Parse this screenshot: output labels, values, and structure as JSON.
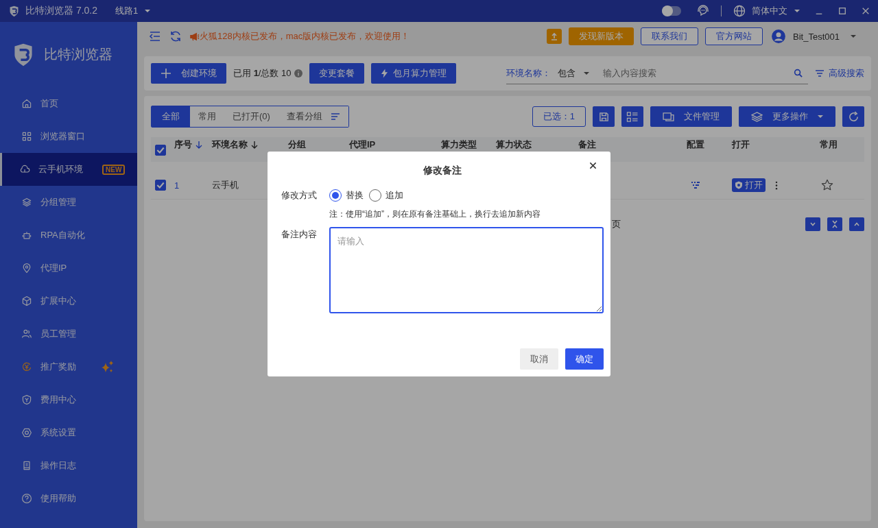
{
  "app": {
    "title": "比特浏览器 7.0.2",
    "line": "线路1",
    "language": "简体中文",
    "dark_mode": false
  },
  "sidebar": {
    "brand": "比特浏览器",
    "items": [
      {
        "label": "首页",
        "selected": false
      },
      {
        "label": "浏览器窗口",
        "selected": false
      },
      {
        "label": "云手机环境",
        "selected": true,
        "badge": "NEW"
      },
      {
        "label": "分组管理",
        "selected": false
      },
      {
        "label": "RPA自动化",
        "selected": false
      },
      {
        "label": "代理IP",
        "selected": false
      },
      {
        "label": "扩展中心",
        "selected": false
      },
      {
        "label": "员工管理",
        "selected": false
      },
      {
        "label": "推广奖励",
        "selected": false,
        "sparkle": true
      },
      {
        "label": "费用中心",
        "selected": false
      },
      {
        "label": "系统设置",
        "selected": false
      },
      {
        "label": "操作日志",
        "selected": false
      },
      {
        "label": "使用帮助",
        "selected": false
      }
    ]
  },
  "header": {
    "notice": "火狐128内核已发布，mac版内核已发布，欢迎使用！",
    "update": "发现新版本",
    "contact": "联系我们",
    "website": "官方网站",
    "user": "Bit_Test001"
  },
  "toolbar": {
    "create": "创建环境",
    "usage": "已用 **1**/总数 10",
    "change_plan": "变更套餐",
    "compute": "包月算力管理",
    "filter_label": "环境名称：",
    "filter_mode": "包含",
    "search": {
      "placeholder": "输入内容搜索"
    },
    "advanced": "高级搜索"
  },
  "tabs": [
    {
      "label": "全部",
      "selected": true
    },
    {
      "label": "常用",
      "selected": false
    },
    {
      "label": "已打开(0)",
      "selected": false
    },
    {
      "label": "查看分组",
      "selected": false
    }
  ],
  "actions": {
    "selected_count": "已选：1",
    "files": "文件管理",
    "more": "更多操作"
  },
  "table": {
    "all_checked": true,
    "columns": [
      "序号",
      "环境名称",
      "分组",
      "代理IP",
      "算力类型",
      "算力状态",
      "备注",
      "配置",
      "打开",
      "常用"
    ],
    "rows": [
      {
        "checked": true,
        "index": "1",
        "name": "云手机",
        "open": "打开",
        "favorite": false
      }
    ]
  },
  "pager": {
    "text": "页"
  },
  "dialog": {
    "title": "修改备注",
    "mode_label": "修改方式",
    "options": [
      {
        "label": "替换",
        "selected": true
      },
      {
        "label": "追加",
        "selected": false
      }
    ],
    "note": "注：使用“追加”，则在原有备注基础上，换行去追加新内容",
    "content_label": "备注内容",
    "content": {
      "placeholder": "请输入"
    },
    "cancel": "取消",
    "ok": "确定"
  }
}
